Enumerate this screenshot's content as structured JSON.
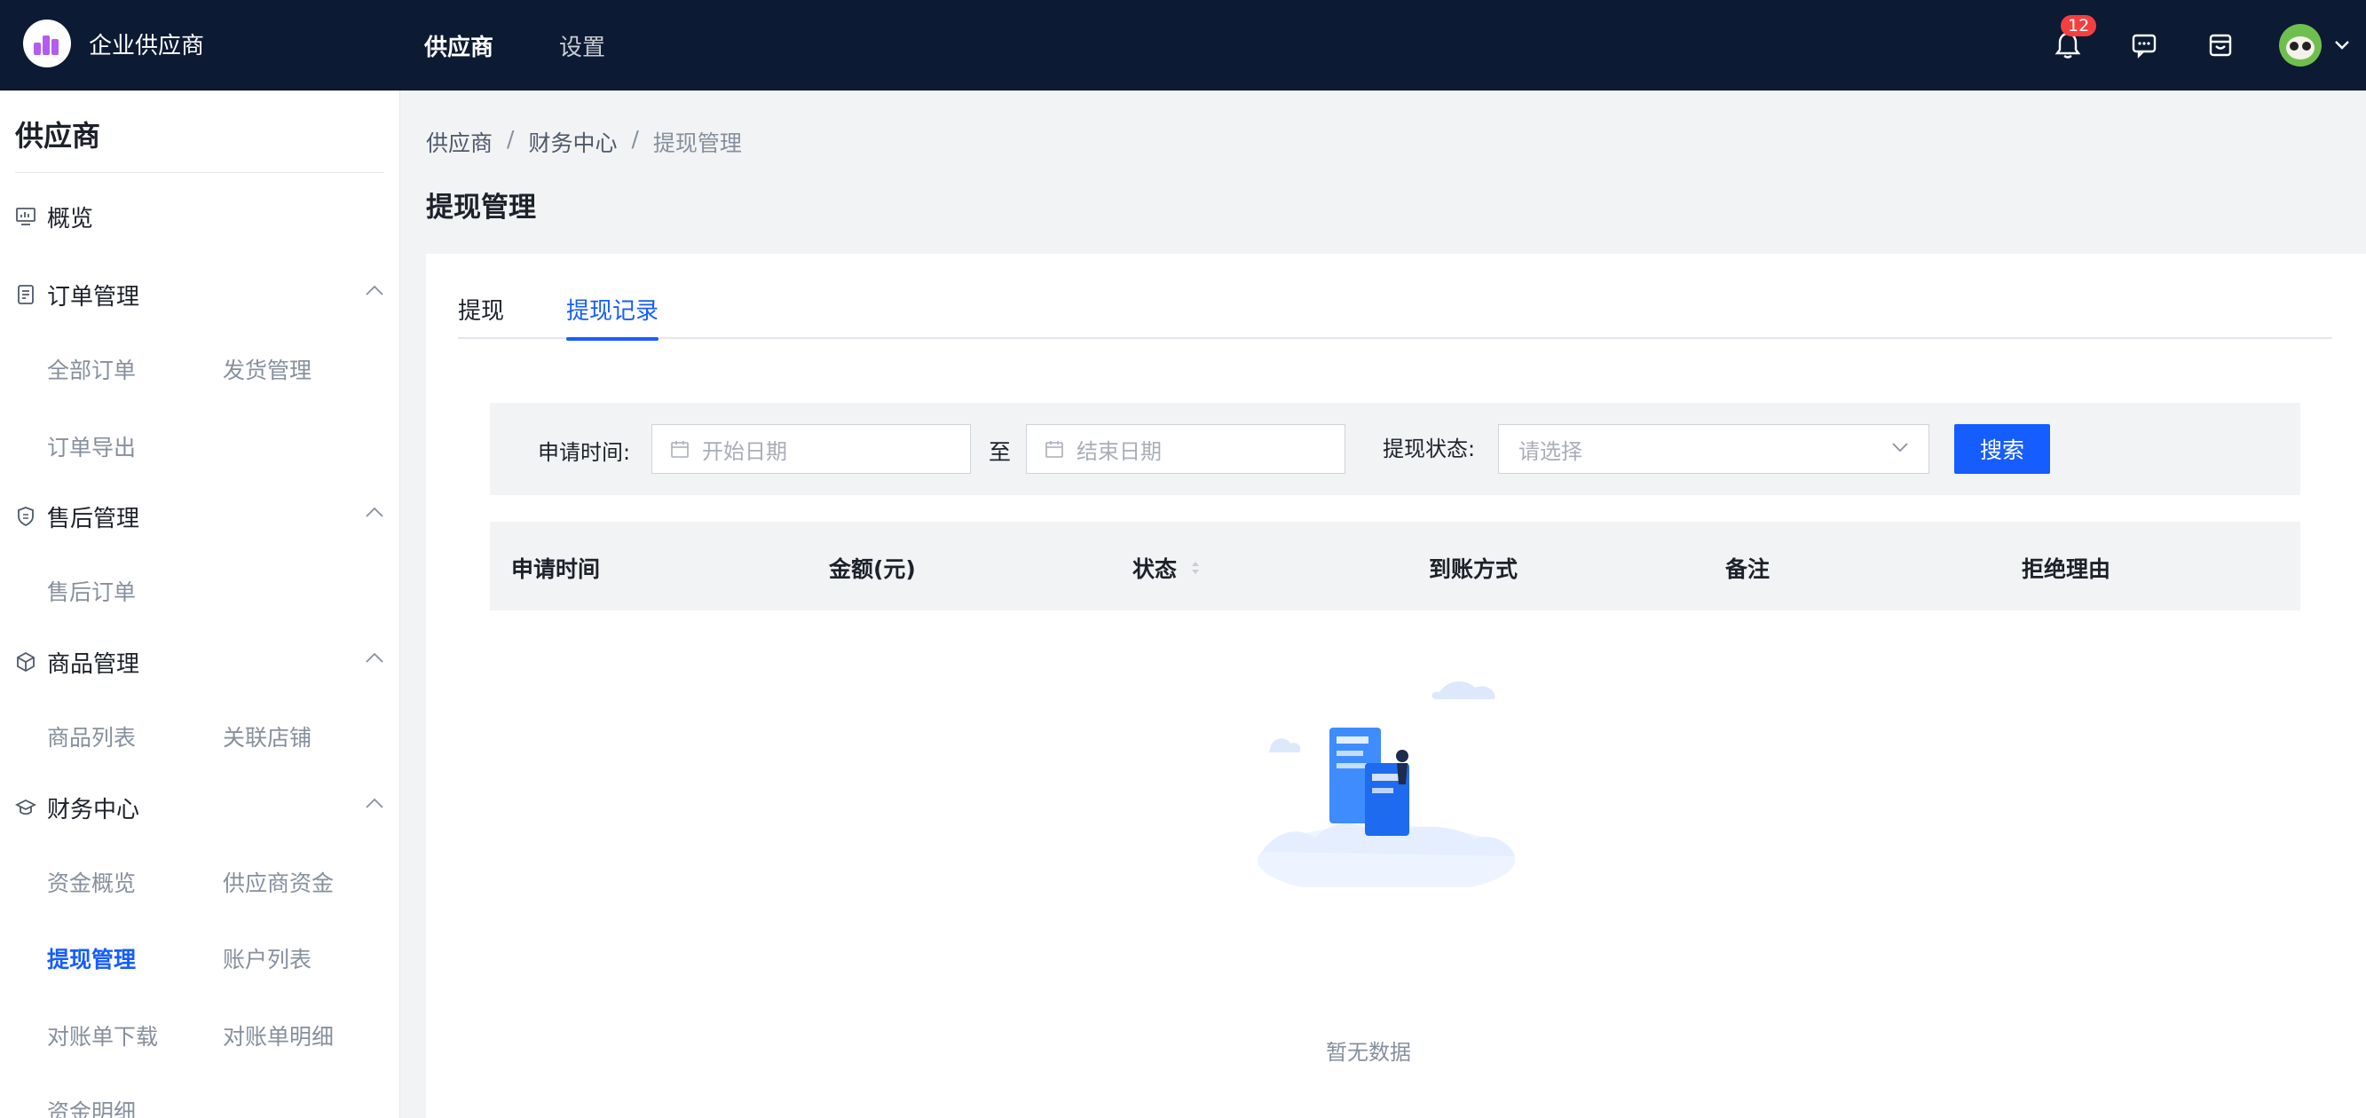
{
  "header": {
    "brand_name": "企业供应商",
    "nav": [
      {
        "label": "供应商",
        "active": true
      },
      {
        "label": "设置",
        "active": false
      }
    ],
    "notification_count": "12",
    "icons": [
      "bell-icon",
      "message-icon",
      "store-icon",
      "avatar",
      "chevron-down-icon"
    ]
  },
  "sidebar": {
    "title": "供应商",
    "groups": [
      {
        "label": "概览",
        "icon": "dashboard-icon",
        "items": []
      },
      {
        "label": "订单管理",
        "icon": "order-icon",
        "items": [
          "全部订单",
          "发货管理",
          "订单导出"
        ]
      },
      {
        "label": "售后管理",
        "icon": "shield-icon",
        "items": [
          "售后订单"
        ]
      },
      {
        "label": "商品管理",
        "icon": "cube-icon",
        "items": [
          "商品列表",
          "关联店铺"
        ]
      },
      {
        "label": "财务中心",
        "icon": "finance-icon",
        "items": [
          "资金概览",
          "供应商资金",
          "提现管理",
          "账户列表",
          "对账单下载",
          "对账单明细",
          "资金明细"
        ]
      }
    ],
    "active_item": "提现管理"
  },
  "breadcrumb": [
    "供应商",
    "财务中心",
    "提现管理"
  ],
  "breadcrumb_sep": "/",
  "page_title": "提现管理",
  "tabs": [
    {
      "label": "提现",
      "active": false
    },
    {
      "label": "提现记录",
      "active": true
    }
  ],
  "filter": {
    "apply_time_label": "申请时间:",
    "start_placeholder": "开始日期",
    "to_label": "至",
    "end_placeholder": "结束日期",
    "status_label": "提现状态:",
    "status_placeholder": "请选择",
    "search_label": "搜索"
  },
  "table": {
    "columns": [
      "申请时间",
      "金额(元)",
      "状态",
      "到账方式",
      "备注",
      "拒绝理由"
    ],
    "rows": []
  },
  "empty_text": "暂无数据",
  "colors": {
    "topbar": "#0c1a33",
    "primary": "#165dff",
    "background": "#f2f3f5"
  }
}
